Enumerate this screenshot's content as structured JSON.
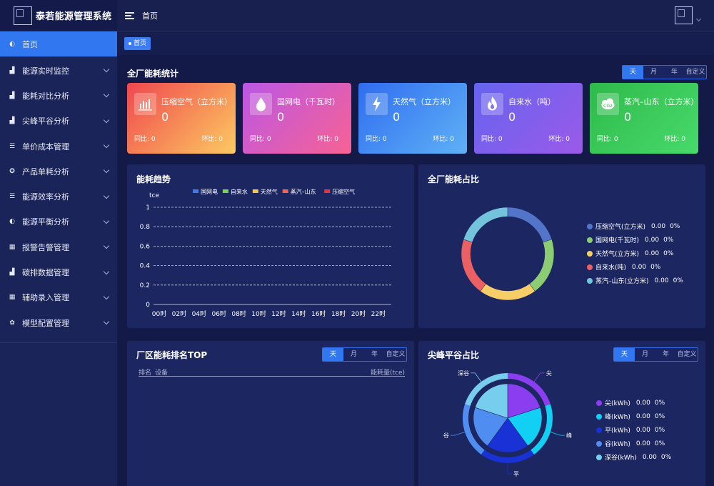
{
  "app": {
    "title": "泰若能源管理系统"
  },
  "topbar": {
    "title": "首页"
  },
  "tabs": {
    "home": "首页"
  },
  "sidebar": {
    "items": [
      {
        "label": "首页",
        "icon": "dashboard-icon",
        "glyph": "◐",
        "active": true,
        "chevron": false
      },
      {
        "label": "能源实时监控",
        "icon": "bar-chart-icon",
        "glyph": "▟",
        "active": false,
        "chevron": true
      },
      {
        "label": "能耗对比分析",
        "icon": "bar-chart-icon",
        "glyph": "▟",
        "active": false,
        "chevron": true
      },
      {
        "label": "尖峰平谷分析",
        "icon": "bar-chart-icon",
        "glyph": "▟",
        "active": false,
        "chevron": true
      },
      {
        "label": "单价成本管理",
        "icon": "list-icon",
        "glyph": "☰",
        "active": false,
        "chevron": true
      },
      {
        "label": "产品单耗分析",
        "icon": "target-icon",
        "glyph": "✪",
        "active": false,
        "chevron": true
      },
      {
        "label": "能源效率分析",
        "icon": "list-icon",
        "glyph": "☰",
        "active": false,
        "chevron": true
      },
      {
        "label": "能源平衡分析",
        "icon": "gauge-icon",
        "glyph": "◐",
        "active": false,
        "chevron": true
      },
      {
        "label": "报警告警管理",
        "icon": "grid-icon",
        "glyph": "▦",
        "active": false,
        "chevron": true
      },
      {
        "label": "碳排数据管理",
        "icon": "bar-chart-icon",
        "glyph": "▟",
        "active": false,
        "chevron": true
      },
      {
        "label": "辅助录入管理",
        "icon": "grid-icon",
        "glyph": "▦",
        "active": false,
        "chevron": true
      },
      {
        "label": "模型配置管理",
        "icon": "gear-icon",
        "glyph": "✿",
        "active": false,
        "chevron": true
      }
    ]
  },
  "plant_stats": {
    "title": "全厂能耗统计",
    "range_options": [
      "天",
      "月",
      "年",
      "自定义"
    ],
    "selected_range": "天",
    "cards": [
      {
        "name": "压缩空气（立方米）",
        "value": "0",
        "yoy_label": "同比: 0",
        "mom_label": "环比: 0",
        "icon": "compressor-icon"
      },
      {
        "name": "国网电（千瓦时）",
        "value": "0",
        "yoy_label": "同比: 0",
        "mom_label": "环比: 0",
        "icon": "water-drop-icon"
      },
      {
        "name": "天然气（立方米）",
        "value": "0",
        "yoy_label": "同比: 0",
        "mom_label": "环比: 0",
        "icon": "lightning-icon"
      },
      {
        "name": "自来水（吨）",
        "value": "0",
        "yoy_label": "同比: 0",
        "mom_label": "环比: 0",
        "icon": "flame-icon"
      },
      {
        "name": "蒸汽–山东（立方米）",
        "value": "0",
        "yoy_label": "同比: 0",
        "mom_label": "环比: 0",
        "icon": "co2-cloud-icon"
      }
    ]
  },
  "trend": {
    "title": "能耗趋势",
    "legend": [
      {
        "name": "国网电",
        "color": "#3f7de6"
      },
      {
        "name": "自来水",
        "color": "#77d64b"
      },
      {
        "name": "天然气",
        "color": "#f9c74a"
      },
      {
        "name": "蒸汽–山东",
        "color": "#f1664e"
      },
      {
        "name": "压缩空气",
        "color": "#e7333f"
      }
    ]
  },
  "chart_data": [
    {
      "type": "line",
      "title": "能耗趋势",
      "ylabel": "tce",
      "ylim": [
        0,
        1
      ],
      "yticks": [
        "0",
        "0.2",
        "0.4",
        "0.6",
        "0.8",
        "1"
      ],
      "x": [
        "00时",
        "02时",
        "04时",
        "06时",
        "08时",
        "10时",
        "12时",
        "14时",
        "16时",
        "18时",
        "20时",
        "22时"
      ],
      "series": [
        {
          "name": "国网电",
          "values": []
        },
        {
          "name": "自来水",
          "values": []
        },
        {
          "name": "天然气",
          "values": []
        },
        {
          "name": "蒸汽–山东",
          "values": []
        },
        {
          "name": "压缩空气",
          "values": []
        }
      ],
      "grid": true,
      "legend": "top"
    },
    {
      "type": "pie",
      "title": "全厂能耗占比",
      "labels": [
        "压缩空气(立方米)",
        "国网电(千瓦时)",
        "天然气(立方米)",
        "自来水(吨)",
        "蒸汽–山东(立方米)"
      ],
      "values": [
        0,
        0,
        0,
        0,
        0
      ],
      "percents": [
        "0%",
        "0%",
        "0%",
        "0%",
        "0%"
      ],
      "value_labels": [
        "0.00",
        "0.00",
        "0.00",
        "0.00",
        "0.00"
      ],
      "colors": [
        "#5274c9",
        "#8ccd73",
        "#f6cd67",
        "#ea6063",
        "#74c3dc"
      ],
      "legend": "right"
    },
    {
      "type": "pie",
      "title": "尖峰平谷占比",
      "labels": [
        "尖(kWh)",
        "峰(kWh)",
        "平(kWh)",
        "谷(kWh)",
        "深谷(kWh)"
      ],
      "slice_labels": [
        "尖",
        "峰",
        "平",
        "谷",
        "深谷"
      ],
      "values": [
        0,
        0,
        0,
        0,
        0
      ],
      "percents": [
        "0%",
        "0%",
        "0%",
        "0%",
        "0%"
      ],
      "value_labels": [
        "0.00",
        "0.00",
        "0.00",
        "0.00",
        "0.00"
      ],
      "colors": [
        "#8b3ef0",
        "#12d0f4",
        "#1832d6",
        "#4f8ef0",
        "#77cdee"
      ],
      "legend": "right"
    }
  ],
  "share": {
    "title": "全厂能耗占比"
  },
  "ranking": {
    "title": "厂区能耗排名TOP",
    "range_options": [
      "天",
      "月",
      "年",
      "自定义"
    ],
    "selected_range": "天",
    "columns": [
      "排名",
      "设备",
      "能耗量(tce)"
    ],
    "rows": []
  },
  "peak": {
    "title": "尖峰平谷占比",
    "range_options": [
      "天",
      "月",
      "年",
      "自定义"
    ],
    "selected_range": "天"
  },
  "colors": {
    "accent": "#3178f0",
    "background": "#141a48",
    "panel": "#1c2660"
  }
}
